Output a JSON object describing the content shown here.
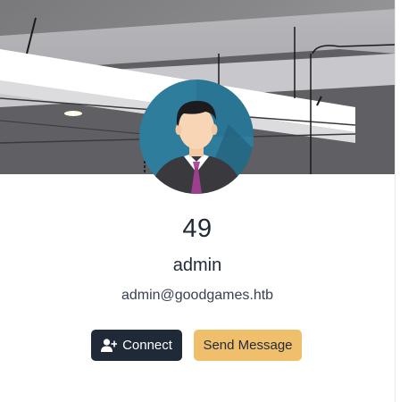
{
  "profile": {
    "count": "49",
    "username": "admin",
    "email": "admin@goodgames.htb"
  },
  "actions": {
    "connect_label": "Connect",
    "connect_icon": "user-plus-icon",
    "message_label": "Send Message"
  },
  "colors": {
    "connect_bg": "#1f2937",
    "message_bg": "#f0bf6c",
    "text_primary": "#1f2937"
  }
}
